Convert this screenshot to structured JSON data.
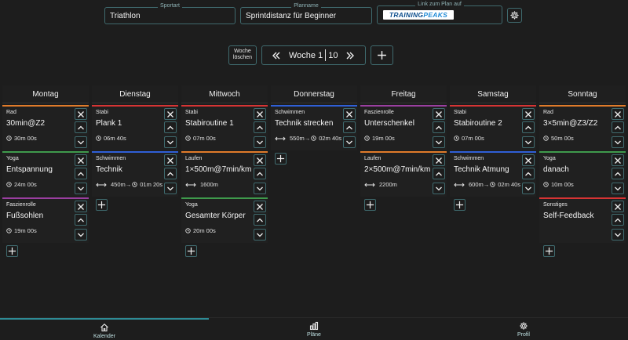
{
  "header": {
    "sport_label": "Sportart",
    "sport_value": "Triathlon",
    "plan_label": "Planname",
    "plan_value": "Sprintdistanz für Beginner",
    "link_label": "Link zum Plan auf",
    "link_logo_text_a": "TRAINING",
    "link_logo_text_b": "PEAKS",
    "settings_icon": "gear-icon"
  },
  "week": {
    "delete_line1": "Woche",
    "delete_line2": "löschen",
    "current": "Woche 1",
    "total": "10"
  },
  "colors": {
    "Rad": "#e07b2a",
    "Yoga": "#3f9a4c",
    "Faszienrolle": "#9a3fa0",
    "Stabi": "#d63434",
    "Schwimmen": "#2f5fd6",
    "Laufen": "#e07b2a",
    "Sonstiges": "#d63434",
    "accent": "#2e8b95"
  },
  "days": [
    {
      "name": "Montag",
      "cards": [
        {
          "cat": "Rad",
          "title": "30min@Z2",
          "time": "30m 00s",
          "dist": "",
          "pace": ""
        },
        {
          "cat": "Yoga",
          "title": "Entspannung",
          "time": "24m 00s",
          "dist": "",
          "pace": ""
        },
        {
          "cat": "Faszienrolle",
          "title": "Fußsohlen",
          "time": "19m 00s",
          "dist": "",
          "pace": ""
        }
      ]
    },
    {
      "name": "Dienstag",
      "cards": [
        {
          "cat": "Stabi",
          "title": "Plank 1",
          "time": "06m 40s",
          "dist": "",
          "pace": ""
        },
        {
          "cat": "Schwimmen",
          "title": "Technik",
          "time": "01m 20s",
          "dist": "450m",
          "pace": ""
        }
      ]
    },
    {
      "name": "Mittwoch",
      "cards": [
        {
          "cat": "Stabi",
          "title": "Stabiroutine 1",
          "time": "07m 00s",
          "dist": "",
          "pace": ""
        },
        {
          "cat": "Laufen",
          "title": "1×500m@7min/km",
          "time": "",
          "dist": "1600m",
          "pace": ""
        },
        {
          "cat": "Yoga",
          "title": "Gesamter Körper",
          "time": "20m 00s",
          "dist": "",
          "pace": ""
        }
      ]
    },
    {
      "name": "Donnerstag",
      "cards": [
        {
          "cat": "Schwimmen",
          "title": "Technik strecken",
          "time": "02m 40s",
          "dist": "550m",
          "pace": ""
        }
      ]
    },
    {
      "name": "Freitag",
      "cards": [
        {
          "cat": "Faszienrolle",
          "title": "Unterschenkel",
          "time": "19m 00s",
          "dist": "",
          "pace": ""
        },
        {
          "cat": "Laufen",
          "title": "2×500m@7min/km",
          "time": "",
          "dist": "2200m",
          "pace": ""
        }
      ]
    },
    {
      "name": "Samstag",
      "cards": [
        {
          "cat": "Stabi",
          "title": "Stabiroutine 2",
          "time": "07m 00s",
          "dist": "",
          "pace": ""
        },
        {
          "cat": "Schwimmen",
          "title": "Technik Atmung",
          "time": "02m 40s",
          "dist": "600m",
          "pace": ""
        }
      ]
    },
    {
      "name": "Sonntag",
      "cards": [
        {
          "cat": "Rad",
          "title": "3×5min@Z3/Z2",
          "time": "50m 00s",
          "dist": "",
          "pace": ""
        },
        {
          "cat": "Yoga",
          "title": "danach",
          "time": "10m 00s",
          "dist": "",
          "pace": ""
        },
        {
          "cat": "Sonstiges",
          "title": "Self-Feedback",
          "time": "",
          "dist": "",
          "pace": ""
        }
      ]
    }
  ],
  "nav": [
    {
      "label": "Kalender",
      "icon": "home-icon",
      "active": true
    },
    {
      "label": "Pläne",
      "icon": "bar-chart-icon",
      "active": false
    },
    {
      "label": "Profil",
      "icon": "gear-icon",
      "active": false
    }
  ]
}
